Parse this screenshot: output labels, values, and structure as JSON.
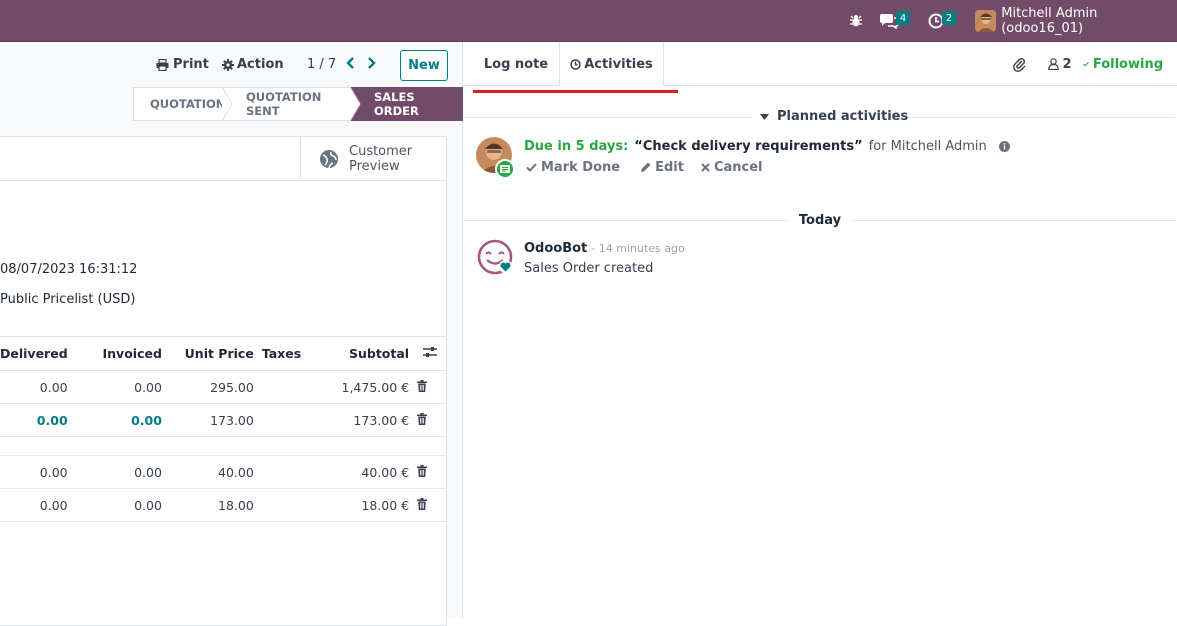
{
  "navbar": {
    "chat_count": "4",
    "activity_count": "2",
    "user_label": "Mitchell Admin (odoo16_01)"
  },
  "control_panel": {
    "print_label": "Print",
    "action_label": "Action",
    "pager": "1 / 7",
    "new_label": "New"
  },
  "status": {
    "stages": [
      "QUOTATION",
      "QUOTATION SENT",
      "SALES ORDER"
    ],
    "active": "SALES ORDER"
  },
  "form": {
    "preview_label_1": "Customer",
    "preview_label_2": "Preview",
    "date_value": "08/07/2023 16:31:12",
    "pricelist_value": "Public Pricelist (USD)"
  },
  "lines": {
    "headers": {
      "delivered": "Delivered",
      "invoiced": "Invoiced",
      "unit_price": "Unit Price",
      "taxes": "Taxes",
      "subtotal": "Subtotal"
    },
    "rows": [
      {
        "delivered": "0.00",
        "invoiced": "0.00",
        "unit_price": "295.00",
        "subtotal": "1,475.00 €"
      },
      {
        "delivered": "0.00",
        "invoiced": "0.00",
        "unit_price": "173.00",
        "subtotal": "173.00 €"
      },
      {
        "delivered": "0.00",
        "invoiced": "0.00",
        "unit_price": "40.00",
        "subtotal": "40.00 €"
      },
      {
        "delivered": "0.00",
        "invoiced": "0.00",
        "unit_price": "18.00",
        "subtotal": "18.00 €"
      }
    ]
  },
  "chatter": {
    "tab_log_note": "Log note",
    "tab_activities": "Activities",
    "followers_count": "2",
    "following_label": "Following",
    "planned_header": "Planned activities",
    "activity": {
      "due": "Due in 5 days:",
      "summary": "“Check delivery requirements”",
      "for": "for Mitchell Admin",
      "mark_done": "Mark Done",
      "edit": "Edit",
      "cancel": "Cancel"
    },
    "today_label": "Today",
    "message": {
      "author": "OdooBot",
      "time": "- 14 minutes ago",
      "body": "Sales Order created"
    }
  },
  "colors": {
    "brand": "#714b67",
    "accent": "#017e84",
    "success": "#28a745",
    "highlight": "#e11d1d"
  }
}
